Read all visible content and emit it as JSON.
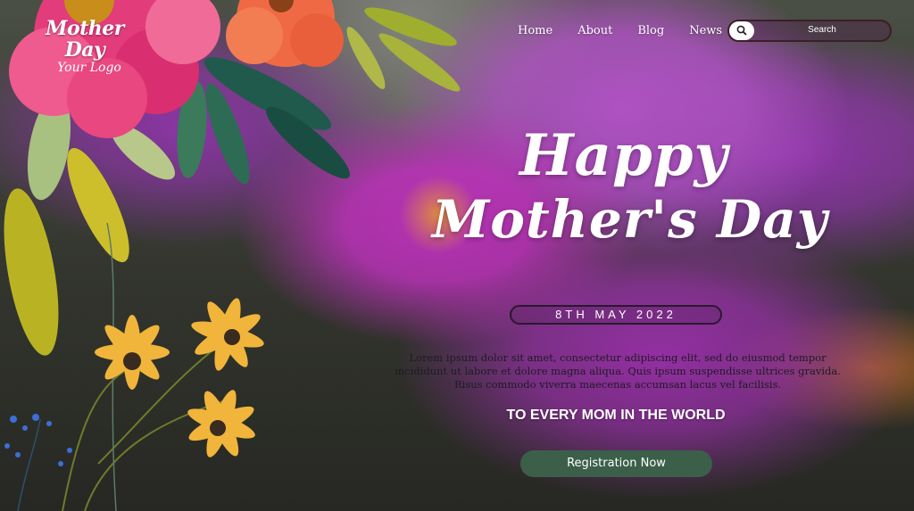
{
  "logo": {
    "title": "Mother Day",
    "subtitle": "Your Logo"
  },
  "nav": {
    "items": [
      "Home",
      "About",
      "Blog",
      "News"
    ]
  },
  "search": {
    "placeholder": "Search",
    "icon": "search-icon"
  },
  "hero": {
    "line1": "Happy",
    "line2": "Mother's Day",
    "date": "8TH MAY 2022",
    "body": "Lorem ipsum dolor sit amet, consectetur adipiscing elit, sed do eiusmod tempor incididunt ut labore et dolore magna aliqua. Quis ipsum suspendisse ultrices gravida. Risus commodo viverra maecenas accumsan lacus vel facilisis.",
    "tagline": "TO EVERY MOM IN THE WORLD",
    "cta": "Registration Now"
  },
  "colors": {
    "button": "#3c5f4a",
    "accent_pink": "#e23c7b",
    "accent_orange": "#ef6a44",
    "accent_yellow": "#f0b53a"
  }
}
